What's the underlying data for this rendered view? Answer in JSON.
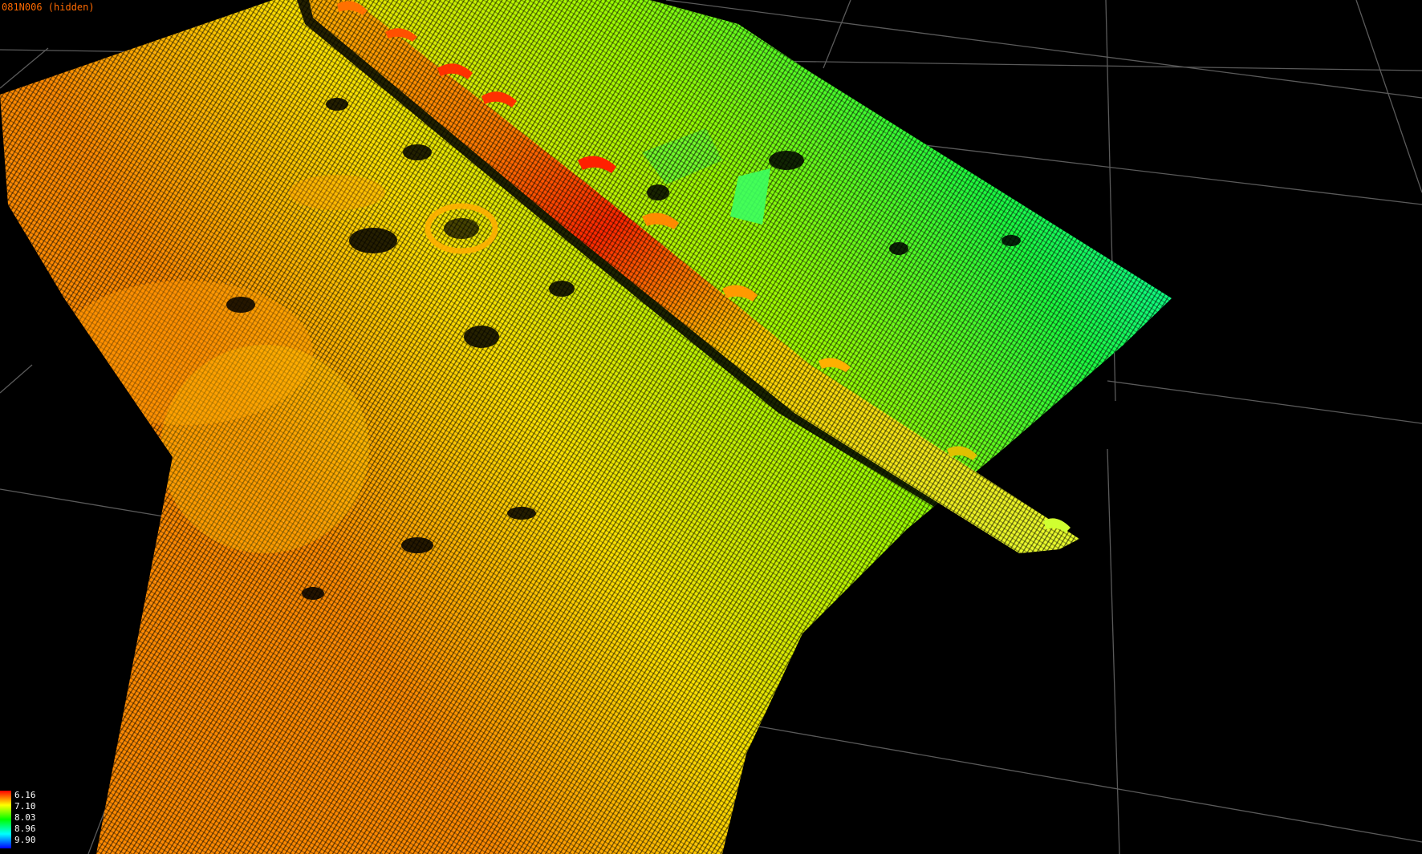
{
  "viewport": {
    "layer_label": "081N006 (hidden)",
    "layer_label_color": "#ff6a00",
    "background_color": "#000000",
    "grid_color": "#5a5a5a"
  },
  "legend": {
    "values": [
      "6.16",
      "7.10",
      "8.03",
      "8.96",
      "9.90"
    ],
    "colors": [
      "#ff0000",
      "#ffff00",
      "#00ff00",
      "#00ffff",
      "#0000ff"
    ]
  },
  "pointcloud": {
    "colormap": [
      "#ff0000",
      "#ffa500",
      "#ffff00",
      "#00ff00",
      "#00ffff",
      "#0000ff"
    ]
  }
}
